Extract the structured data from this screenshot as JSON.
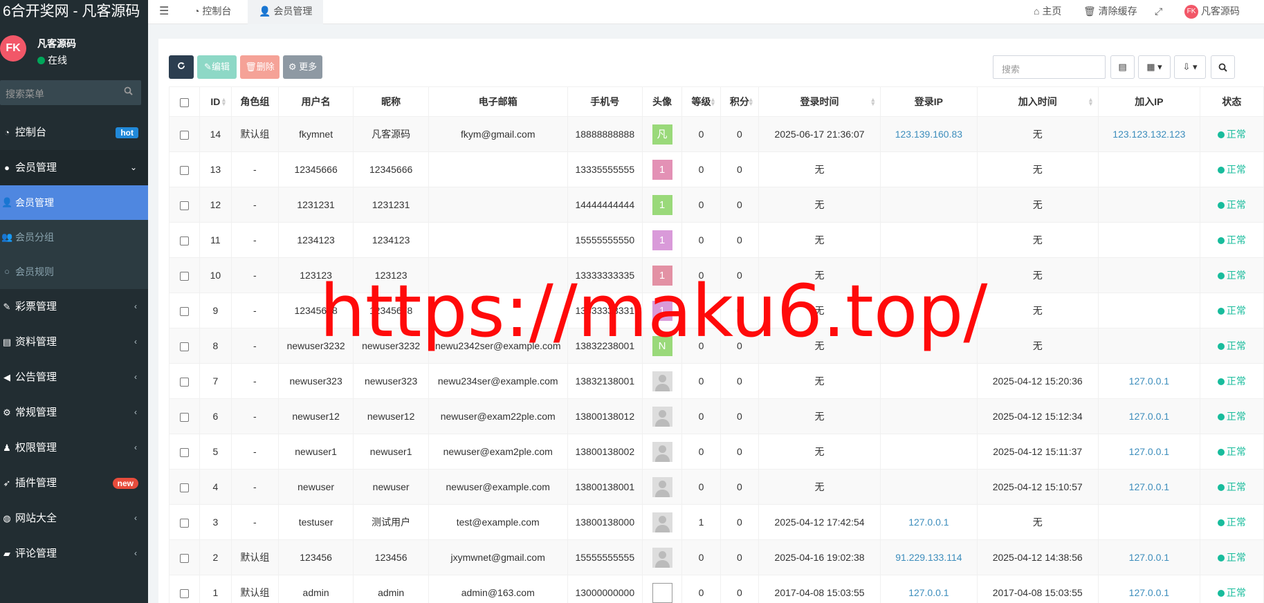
{
  "app": {
    "title": "6合开奖网 - 凡客源码"
  },
  "user": {
    "avatar_text": "FK",
    "name": "凡客源码",
    "status": "在线"
  },
  "sidebar": {
    "search_placeholder": "搜索菜单",
    "items": [
      {
        "label": "控制台",
        "badge": "hot",
        "badge_color": "#2189d9"
      },
      {
        "label": "会员管理",
        "open": true
      },
      {
        "label": "彩票管理"
      },
      {
        "label": "资料管理"
      },
      {
        "label": "公告管理"
      },
      {
        "label": "常规管理"
      },
      {
        "label": "权限管理"
      },
      {
        "label": "插件管理",
        "badge": "new",
        "badge_color": "#e74c3c"
      },
      {
        "label": "网站大全"
      },
      {
        "label": "评论管理"
      }
    ],
    "sub_items": [
      {
        "label": "会员管理",
        "active": true
      },
      {
        "label": "会员分组"
      },
      {
        "label": "会员规则"
      }
    ]
  },
  "topbar": {
    "menu_icon": "bars-icon",
    "tabs": [
      {
        "label": "控制台"
      },
      {
        "label": "会员管理",
        "active": true
      }
    ],
    "right": {
      "home": "主页",
      "clear_cache": "清除缓存",
      "user": "凡客源码"
    }
  },
  "toolbar": {
    "refresh_icon": "refresh-icon",
    "edit_label": "编辑",
    "delete_label": "删除",
    "more_label": "更多",
    "search_placeholder": "搜索"
  },
  "table": {
    "headers": [
      "",
      "ID",
      "角色组",
      "用户名",
      "昵称",
      "电子邮箱",
      "手机号",
      "头像",
      "等级",
      "积分",
      "登录时间",
      "登录IP",
      "加入时间",
      "加入IP",
      "状态"
    ],
    "rows": [
      {
        "id": "14",
        "group": "默认组",
        "username": "fkymnet",
        "nickname": "凡客源码",
        "email": "fkym@gmail.com",
        "mobile": "18888888888",
        "avatar": "凡",
        "avatar_color": "#9ad97a",
        "level": "0",
        "score": "0",
        "logintime": "2025-06-17 21:36:07",
        "loginip": "123.139.160.83",
        "jointime": "无",
        "joinip": "123.123.132.123",
        "status": "正常"
      },
      {
        "id": "13",
        "group": "-",
        "username": "12345666",
        "nickname": "12345666",
        "email": "",
        "mobile": "13335555555",
        "avatar": "1",
        "avatar_color": "#e391b5",
        "level": "0",
        "score": "0",
        "logintime": "无",
        "loginip": "",
        "jointime": "无",
        "joinip": "",
        "status": "正常"
      },
      {
        "id": "12",
        "group": "-",
        "username": "1231231",
        "nickname": "1231231",
        "email": "",
        "mobile": "14444444444",
        "avatar": "1",
        "avatar_color": "#9ad97a",
        "level": "0",
        "score": "0",
        "logintime": "无",
        "loginip": "",
        "jointime": "无",
        "joinip": "",
        "status": "正常"
      },
      {
        "id": "11",
        "group": "-",
        "username": "1234123",
        "nickname": "1234123",
        "email": "",
        "mobile": "15555555550",
        "avatar": "1",
        "avatar_color": "#d99ad9",
        "level": "0",
        "score": "0",
        "logintime": "无",
        "loginip": "",
        "jointime": "无",
        "joinip": "",
        "status": "正常"
      },
      {
        "id": "10",
        "group": "-",
        "username": "123123",
        "nickname": "123123",
        "email": "",
        "mobile": "13333333335",
        "avatar": "1",
        "avatar_color": "#e391a4",
        "level": "0",
        "score": "0",
        "logintime": "无",
        "loginip": "",
        "jointime": "无",
        "joinip": "",
        "status": "正常"
      },
      {
        "id": "9",
        "group": "-",
        "username": "12345678",
        "nickname": "12345678",
        "email": "",
        "mobile": "13333333331",
        "avatar": "1",
        "avatar_color": "#d99ad9",
        "level": "0",
        "score": "0",
        "logintime": "无",
        "loginip": "",
        "jointime": "无",
        "joinip": "",
        "status": "正常"
      },
      {
        "id": "8",
        "group": "-",
        "username": "newuser3232",
        "nickname": "newuser3232",
        "email": "newu2342ser@example.com",
        "mobile": "13832238001",
        "avatar": "N",
        "avatar_color": "#9ad97a",
        "level": "0",
        "score": "0",
        "logintime": "无",
        "loginip": "",
        "jointime": "无",
        "joinip": "",
        "status": "正常"
      },
      {
        "id": "7",
        "group": "-",
        "username": "newuser323",
        "nickname": "newuser323",
        "email": "newu234ser@example.com",
        "mobile": "13832138001",
        "avatar": "",
        "level": "0",
        "score": "0",
        "logintime": "无",
        "loginip": "",
        "jointime": "2025-04-12 15:20:36",
        "joinip": "127.0.0.1",
        "status": "正常"
      },
      {
        "id": "6",
        "group": "-",
        "username": "newuser12",
        "nickname": "newuser12",
        "email": "newuser@exam22ple.com",
        "mobile": "13800138012",
        "avatar": "",
        "level": "0",
        "score": "0",
        "logintime": "无",
        "loginip": "",
        "jointime": "2025-04-12 15:12:34",
        "joinip": "127.0.0.1",
        "status": "正常"
      },
      {
        "id": "5",
        "group": "-",
        "username": "newuser1",
        "nickname": "newuser1",
        "email": "newuser@exam2ple.com",
        "mobile": "13800138002",
        "avatar": "",
        "level": "0",
        "score": "0",
        "logintime": "无",
        "loginip": "",
        "jointime": "2025-04-12 15:11:37",
        "joinip": "127.0.0.1",
        "status": "正常"
      },
      {
        "id": "4",
        "group": "-",
        "username": "newuser",
        "nickname": "newuser",
        "email": "newuser@example.com",
        "mobile": "13800138001",
        "avatar": "",
        "level": "0",
        "score": "0",
        "logintime": "无",
        "loginip": "",
        "jointime": "2025-04-12 15:10:57",
        "joinip": "127.0.0.1",
        "status": "正常"
      },
      {
        "id": "3",
        "group": "-",
        "username": "testuser",
        "nickname": "测试用户",
        "email": "test@example.com",
        "mobile": "13800138000",
        "avatar": "",
        "level": "1",
        "score": "0",
        "logintime": "2025-04-12 17:42:54",
        "loginip": "127.0.0.1",
        "jointime": "无",
        "joinip": "",
        "status": "正常"
      },
      {
        "id": "2",
        "group": "默认组",
        "username": "123456",
        "nickname": "123456",
        "email": "jxymwnet@gmail.com",
        "mobile": "15555555555",
        "avatar": "",
        "level": "0",
        "score": "0",
        "logintime": "2025-04-16 19:02:38",
        "loginip": "91.229.133.114",
        "jointime": "2025-04-12 14:38:56",
        "joinip": "127.0.0.1",
        "status": "正常"
      },
      {
        "id": "1",
        "group": "默认组",
        "username": "admin",
        "nickname": "admin",
        "email": "admin@163.com",
        "mobile": "13000000000",
        "avatar": "broken",
        "level": "0",
        "score": "0",
        "logintime": "2017-04-08 15:03:55",
        "loginip": "127.0.0.1",
        "jointime": "2017-04-08 15:03:55",
        "joinip": "127.0.0.1",
        "status": "正常"
      }
    ]
  },
  "watermark": "https://maku6.top/"
}
